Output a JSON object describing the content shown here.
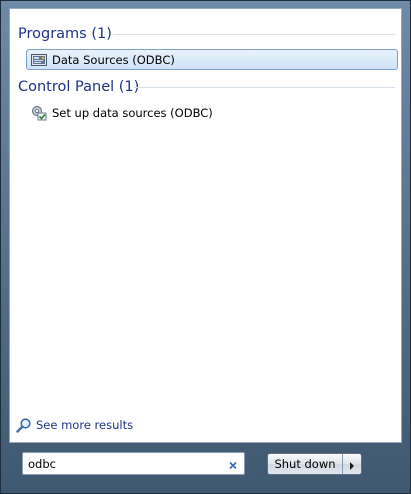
{
  "groups": [
    {
      "header": "Programs (1)",
      "items": [
        {
          "label": "Data Sources (ODBC)",
          "icon": "odbc-admin-icon",
          "selected": true
        }
      ]
    },
    {
      "header": "Control Panel (1)",
      "items": [
        {
          "label": "Set up data sources (ODBC)",
          "icon": "control-panel-tools-icon",
          "selected": false
        }
      ]
    }
  ],
  "see_more": {
    "label": "See more results",
    "icon": "search-icon"
  },
  "search": {
    "value": "odbc",
    "clear_icon": "clear-x-icon"
  },
  "shutdown": {
    "label": "Shut down",
    "arrow_icon": "arrow-right-icon"
  },
  "colors": {
    "group_header": "#1e3287",
    "selection_border": "#7da2ce",
    "menu_frame": "#4f6a86"
  }
}
